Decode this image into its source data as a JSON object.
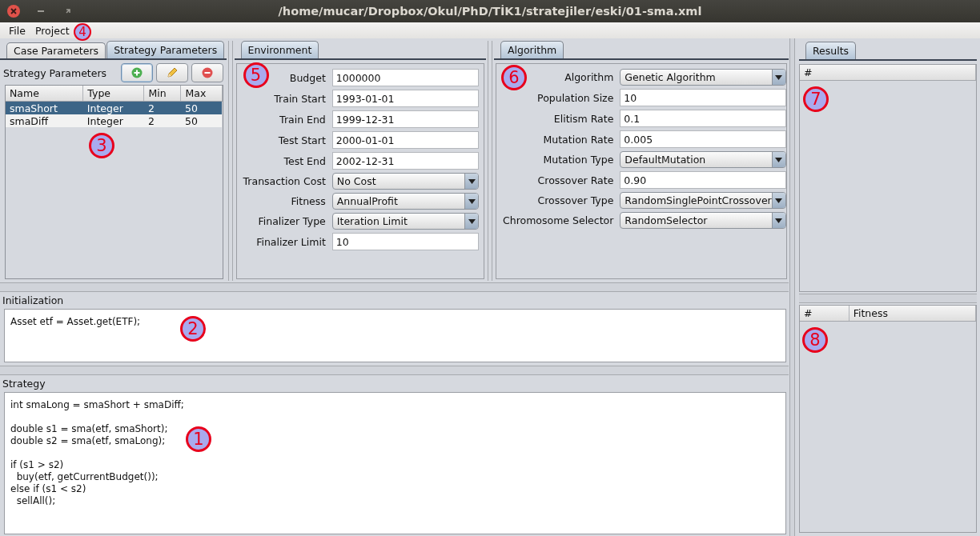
{
  "window": {
    "title": "/home/mucar/Dropbox/Okul/PhD/TİK1/stratejiler/eski/01-sma.xml"
  },
  "menu": [
    "File",
    "Project"
  ],
  "left_tabs": {
    "callout": "4",
    "tabs": [
      {
        "label": "Case Parameters",
        "selected": false
      },
      {
        "label": "Strategy Parameters",
        "selected": true
      }
    ]
  },
  "strategy_parameters": {
    "title": "Strategy Parameters",
    "callout": "3",
    "columns": [
      "Name",
      "Type",
      "Min",
      "Max"
    ],
    "rows": [
      {
        "cells": [
          "smaShort",
          "Integer",
          "2",
          "50"
        ],
        "selected": true
      },
      {
        "cells": [
          "smaDiff",
          "Integer",
          "2",
          "50"
        ],
        "selected": false
      }
    ]
  },
  "environment": {
    "tab": {
      "label": "Environment",
      "selected": true
    },
    "callout": "5",
    "fields": [
      {
        "label": "Budget",
        "value": "1000000",
        "kind": "text"
      },
      {
        "label": "Train Start",
        "value": "1993-01-01",
        "kind": "text"
      },
      {
        "label": "Train End",
        "value": "1999-12-31",
        "kind": "text"
      },
      {
        "label": "Test Start",
        "value": "2000-01-01",
        "kind": "text"
      },
      {
        "label": "Test End",
        "value": "2002-12-31",
        "kind": "text"
      },
      {
        "label": "Transaction Cost",
        "value": "No Cost",
        "kind": "dropdown"
      },
      {
        "label": "Fitness",
        "value": "AnnualProfit",
        "kind": "dropdown"
      },
      {
        "label": "Finalizer Type",
        "value": "Iteration Limit",
        "kind": "dropdown"
      },
      {
        "label": "Finalizer Limit",
        "value": "10",
        "kind": "text"
      }
    ]
  },
  "algorithm": {
    "tab": {
      "label": "Algorithm",
      "selected": true
    },
    "callout": "6",
    "fields": [
      {
        "label": "Algorithm",
        "value": "Genetic Algorithm",
        "kind": "dropdown"
      },
      {
        "label": "Population Size",
        "value": "10",
        "kind": "text"
      },
      {
        "label": "Elitism Rate",
        "value": "0.1",
        "kind": "text"
      },
      {
        "label": "Mutation Rate",
        "value": "0.005",
        "kind": "text"
      },
      {
        "label": "Mutation Type",
        "value": "DefaultMutation",
        "kind": "dropdown"
      },
      {
        "label": "Crossover Rate",
        "value": "0.90",
        "kind": "text"
      },
      {
        "label": "Crossover Type",
        "value": "RandomSinglePointCrossover",
        "kind": "dropdown"
      },
      {
        "label": "Chromosome Selector",
        "value": "RandomSelector",
        "kind": "dropdown"
      }
    ]
  },
  "initialization": {
    "title": "Initialization",
    "callout": "2",
    "code": "Asset etf = Asset.get(ETF);"
  },
  "strategy": {
    "title": "Strategy",
    "callout": "1",
    "code": "int smaLong = smaShort + smaDiff;\n\ndouble s1 = sma(etf, smaShort);\ndouble s2 = sma(etf, smaLong);\n\nif (s1 > s2)\n  buy(etf, getCurrentBudget());\nelse if (s1 < s2)\n  sellAll();"
  },
  "results": {
    "tab": {
      "label": "Results",
      "selected": true
    },
    "callout": "7",
    "columns": [
      "#"
    ]
  },
  "results_lower": {
    "callout": "8",
    "columns": [
      "#",
      "Fitness"
    ]
  }
}
